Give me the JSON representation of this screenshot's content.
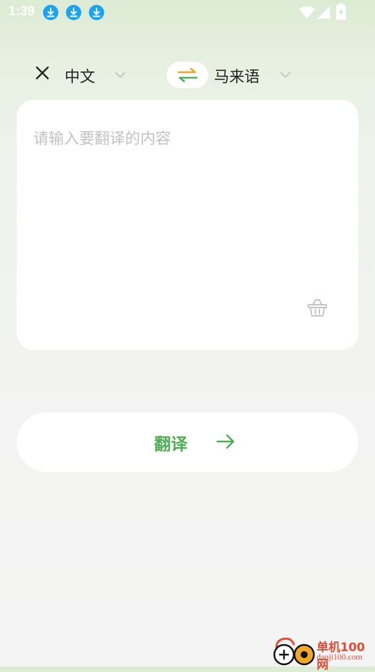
{
  "status_bar": {
    "time": "1:39",
    "notification_icons": [
      "download-icon",
      "download-icon",
      "download-icon"
    ],
    "right_icons": [
      "wifi-icon",
      "signal-icon",
      "battery-charging-icon"
    ]
  },
  "language_bar": {
    "close_icon": "close-icon",
    "source_language": "中文",
    "target_language": "马来语",
    "swap_icon": "swap-arrows-icon"
  },
  "input": {
    "value": "",
    "placeholder": "请输入要翻译的内容",
    "clear_icon": "basket-clear-icon"
  },
  "translate_button": {
    "label": "翻译",
    "icon": "arrow-right-icon"
  },
  "watermark": {
    "title": "单机100网",
    "url": "danji100.com"
  },
  "colors": {
    "accent_green": "#4fae54",
    "swap_orange": "#f2a628",
    "download_blue": "#1aa3f0",
    "watermark_red": "#e24b35"
  }
}
